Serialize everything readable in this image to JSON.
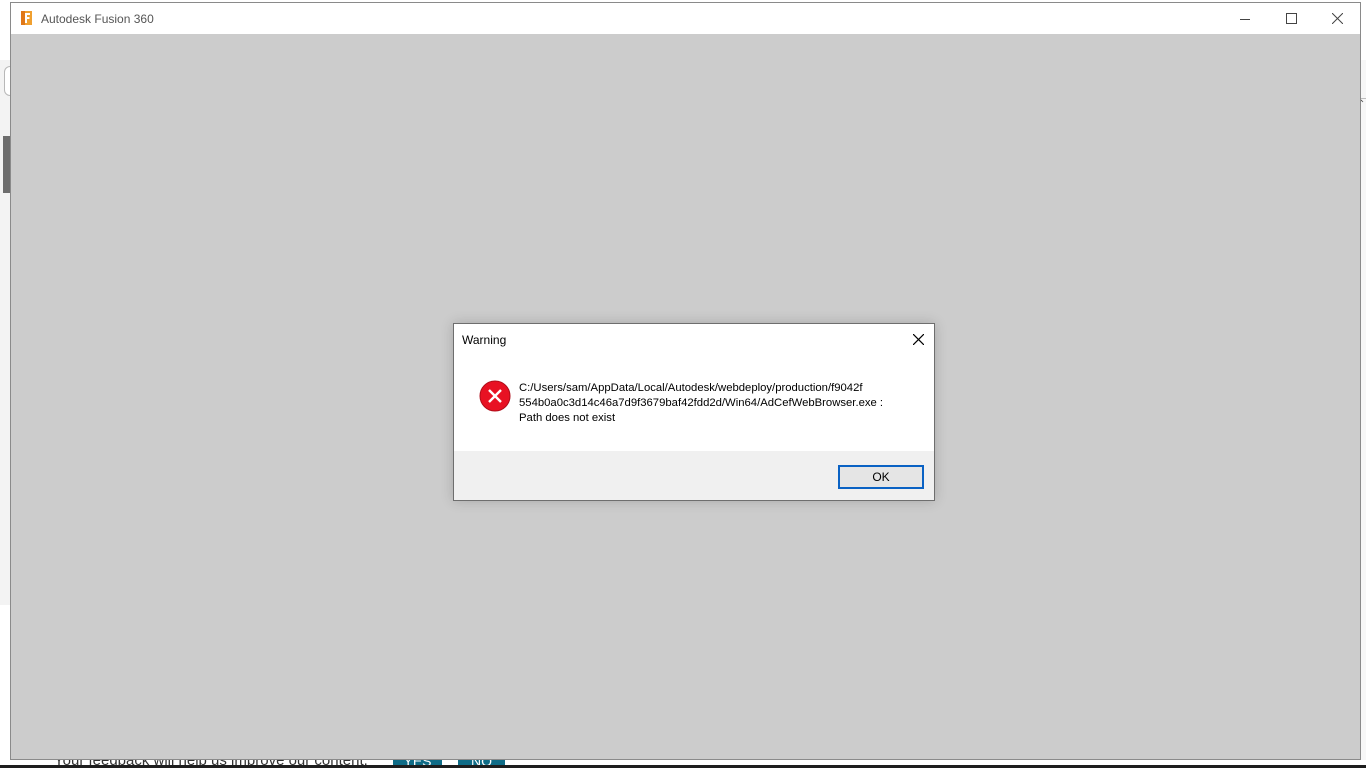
{
  "window": {
    "title": "Autodesk Fusion 360",
    "controls": [
      "minimize",
      "maximize",
      "close"
    ]
  },
  "dialog": {
    "title": "Warning",
    "icon": "error-icon",
    "message_line1": "C:/Users/sam/AppData/Local/Autodesk/webdeploy/production/f9042f",
    "message_line2": "554b0a0c3d14c46a7d9f3679baf42fdd2d/Win64/AdCefWebBrowser.exe :",
    "message_line3": "Path does not exist",
    "ok_label": "OK"
  },
  "background": {
    "feedback_text": "Your feedback will help us improve our content.",
    "yes_label": "YES",
    "no_label": "NO"
  },
  "colors": {
    "error_red": "#e81123",
    "ok_border": "#0a62c4",
    "app_bg": "#cccccc",
    "feedback_button": "#0f6c87"
  }
}
